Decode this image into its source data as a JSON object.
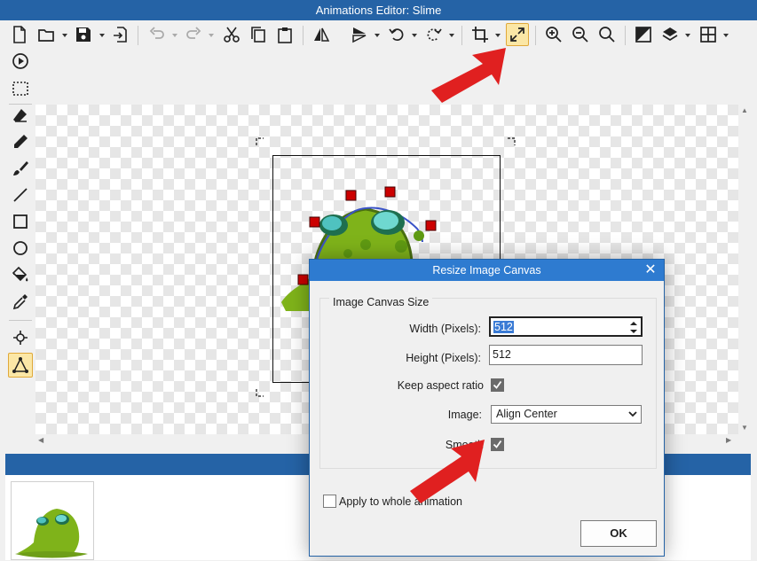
{
  "window": {
    "title": "Animations Editor: Slime"
  },
  "toolbar": {
    "icons": [
      "new-file-icon",
      "open-folder-icon",
      "save-icon",
      "export-icon",
      "undo-icon",
      "redo-icon",
      "cut-icon",
      "copy-icon",
      "paste-icon",
      "flip-horizontal-icon",
      "flip-vertical-icon",
      "rotate-left-icon",
      "rotate-right-icon",
      "crop-icon",
      "resize-canvas-icon",
      "zoom-in-icon",
      "zoom-out-icon",
      "zoom-fit-icon",
      "background-icon",
      "layers-icon",
      "grid-icon"
    ],
    "highlighted": "resize-canvas-icon"
  },
  "left_tools": [
    "play-icon",
    "selection-icon",
    "eraser-icon",
    "pencil-icon",
    "brush-icon",
    "line-icon",
    "rectangle-icon",
    "ellipse-icon",
    "fill-bucket-icon",
    "eyedropper-icon",
    "point-icon",
    "polygon-icon"
  ],
  "dialog": {
    "title": "Resize Image Canvas",
    "group_title": "Image Canvas Size",
    "width_label": "Width (Pixels):",
    "width_value": "512",
    "height_label": "Height (Pixels):",
    "height_value": "512",
    "keep_aspect_label": "Keep aspect ratio",
    "keep_aspect_checked": true,
    "image_label": "Image:",
    "image_option": "Align Center",
    "smooth_label": "Smooth",
    "smooth_checked": true,
    "apply_label": "Apply to whole animation",
    "apply_checked": false,
    "ok_label": "OK"
  },
  "colors": {
    "accent": "#2563a6",
    "dialog_title": "#2e7bd0",
    "annotation_arrow": "#e02020"
  }
}
